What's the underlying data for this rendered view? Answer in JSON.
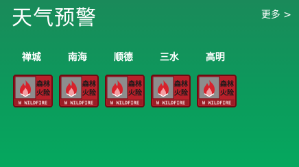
{
  "header": {
    "title": "天气预警",
    "more_label": "更多 >"
  },
  "regions": [
    "禅城",
    "南海",
    "顺德",
    "三水",
    "高明"
  ],
  "warnings": [
    {
      "line1": "森林",
      "line2": "火险",
      "caption": "W  WILDFIRE",
      "icon": "flame-icon"
    },
    {
      "line1": "森林",
      "line2": "火险",
      "caption": "W  WILDFIRE",
      "icon": "flame-icon"
    },
    {
      "line1": "森林",
      "line2": "火险",
      "caption": "W  WILDFIRE",
      "icon": "flame-icon"
    },
    {
      "line1": "森林",
      "line2": "火险",
      "caption": "W  WILDFIRE",
      "icon": "flame-icon"
    },
    {
      "line1": "森林",
      "line2": "火险",
      "caption": "W  WILDFIRE",
      "icon": "flame-icon"
    }
  ],
  "colors": {
    "background_top": "#1a8a5a",
    "background_bottom": "#05a85e",
    "badge_red": "#b8202a",
    "badge_gray": "#8d8d8d",
    "text": "#ffffff"
  }
}
